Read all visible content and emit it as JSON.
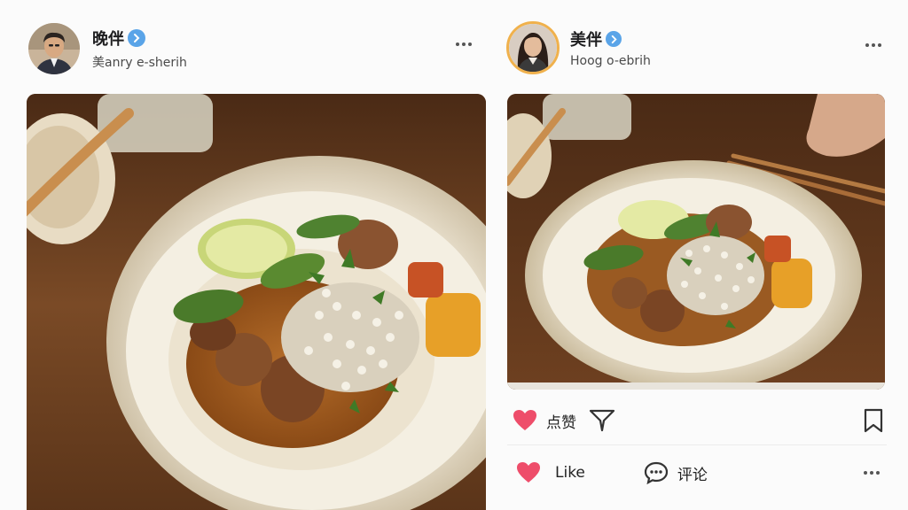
{
  "posts": [
    {
      "author": {
        "name": "晚伴",
        "handle": "美anry e-sherih",
        "verified_icon": "verified-badge-icon"
      },
      "more_icon": "more-horizontal-icon",
      "photo_alt": "braised dish on scalloped plate"
    },
    {
      "author": {
        "name": "美伴",
        "handle": "Hoog o-ebrih",
        "verified_icon": "verified-badge-icon"
      },
      "more_icon": "more-horizontal-icon",
      "photo_alt": "braised dish with chopsticks"
    }
  ],
  "actions": {
    "row1": {
      "like_label": "点赞",
      "like_icon": "heart-icon",
      "filter_icon": "filter-icon",
      "bookmark_icon": "bookmark-icon"
    },
    "row2": {
      "like_label": "Like",
      "like_icon": "heart-icon",
      "comment_label": "评论",
      "comment_icon": "comment-bubble-icon",
      "more_icon": "more-horizontal-icon"
    }
  },
  "colors": {
    "heart": "#ee4d6a",
    "verified": "#5aa4e8",
    "avatar_ring": "#f0b14c"
  }
}
